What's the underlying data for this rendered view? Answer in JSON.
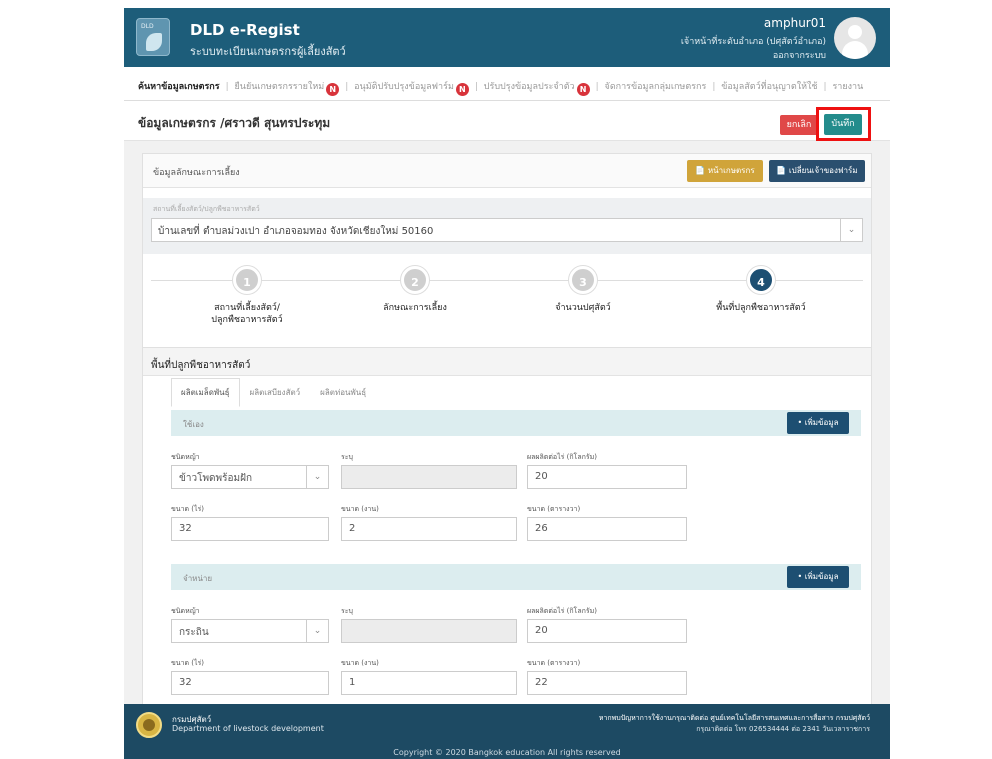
{
  "header": {
    "logo_text": "DLD",
    "title": "DLD e-Regist",
    "subtitle": "ระบบทะเบียนเกษตรกรผู้เลี้ยงสัตว์",
    "user_name": "amphur01",
    "user_role": "เจ้าหน้าที่ระดับอำเภอ (ปศุสัตว์อำเภอ)",
    "logout_label": "ออกจากระบบ"
  },
  "nav": {
    "items": [
      {
        "label": "ค้นหาข้อมูลเกษตรกร",
        "badge": ""
      },
      {
        "label": "ยืนยันเกษตรกรรายใหม่",
        "badge": "N"
      },
      {
        "label": "อนุมัติปรับปรุงข้อมูลฟาร์ม",
        "badge": "N"
      },
      {
        "label": "ปรับปรุงข้อมูลประจำตัว",
        "badge": "N"
      },
      {
        "label": "จัดการข้อมูลกลุ่มเกษตรกร",
        "badge": ""
      },
      {
        "label": "ข้อมูลสัตว์ที่อนุญาตให้ใช้",
        "badge": ""
      },
      {
        "label": "รายงาน",
        "badge": ""
      }
    ]
  },
  "titlebar": {
    "page_title": "ข้อมูลเกษตรกร /ศราวดี สุนทรประทุม",
    "cancel_label": "ยกเลิก",
    "save_label": "บันทึก"
  },
  "livestock_card": {
    "title": "ข้อมูลลักษณะการเลี้ยง",
    "profile_button": "หน้าเกษตรกร",
    "switch_button": "เปลี่ยนเจ้าของฟาร์ม",
    "farm_label": "สถานที่เลี้ยงสัตว์/ปลูกพืชอาหารสัตว์",
    "farm_address": "บ้านเลขที่ ตำบลม่วงเปา อำเภอจอมทอง จังหวัดเชียงใหม่ 50160",
    "steps": [
      {
        "number": "1",
        "label_line1": "สถานที่เลี้ยงสัตว์/",
        "label_line2": "ปลูกพืชอาหารสัตว์"
      },
      {
        "number": "2",
        "label_line1": "ลักษณะการเลี้ยง",
        "label_line2": ""
      },
      {
        "number": "3",
        "label_line1": "จำนวนปศุสัตว์",
        "label_line2": ""
      },
      {
        "number": "4",
        "label_line1": "พื้นที่ปลูกพืชอาหารสัตว์",
        "label_line2": ""
      }
    ],
    "active_step": 4
  },
  "forage_card": {
    "title": "พื้นที่ปลูกพืชอาหารสัตว์",
    "tabs": [
      "ผลิตเมล็ดพันธุ์",
      "ผลิตเสบียงสัตว์",
      "ผลิตท่อนพันธุ์"
    ],
    "add_label": "เพิ่มข้อมูล",
    "field_labels": {
      "grass_type": "ชนิดหญ้า",
      "specify": "ระบุ",
      "yield": "ผลผลิตต่อไร่ (กิโลกรัม)",
      "size_rai": "ขนาด (ไร่)",
      "size_ngan": "ขนาด (งาน)",
      "size_sqwa": "ขนาด (ตารางวา)"
    },
    "sections": [
      {
        "title": "ใช้เอง",
        "grass_type": "ข้าวโพดพร้อมฝัก",
        "specify": "",
        "yield": "20",
        "size_rai": "32",
        "size_ngan": "2",
        "size_sqwa": "26"
      },
      {
        "title": "จำหน่าย",
        "grass_type": "กระถิน",
        "specify": "",
        "yield": "20",
        "size_rai": "32",
        "size_ngan": "1",
        "size_sqwa": "22"
      }
    ]
  },
  "footer": {
    "dept_th": "กรมปศุสัตว์",
    "dept_en": "Department of livestock development",
    "contact_line1": "หากพบปัญหาการใช้งานกรุณาติดต่อ ศูนย์เทคโนโลยีสารสนเทศและการสื่อสาร กรมปศุสัตว์",
    "contact_line2": "กรุณาติดต่อ โทร 026534444 ต่อ 2341 วันเวลาราชการ",
    "copyright": "Copyright © 2020 Bangkok education All rights reserved"
  }
}
